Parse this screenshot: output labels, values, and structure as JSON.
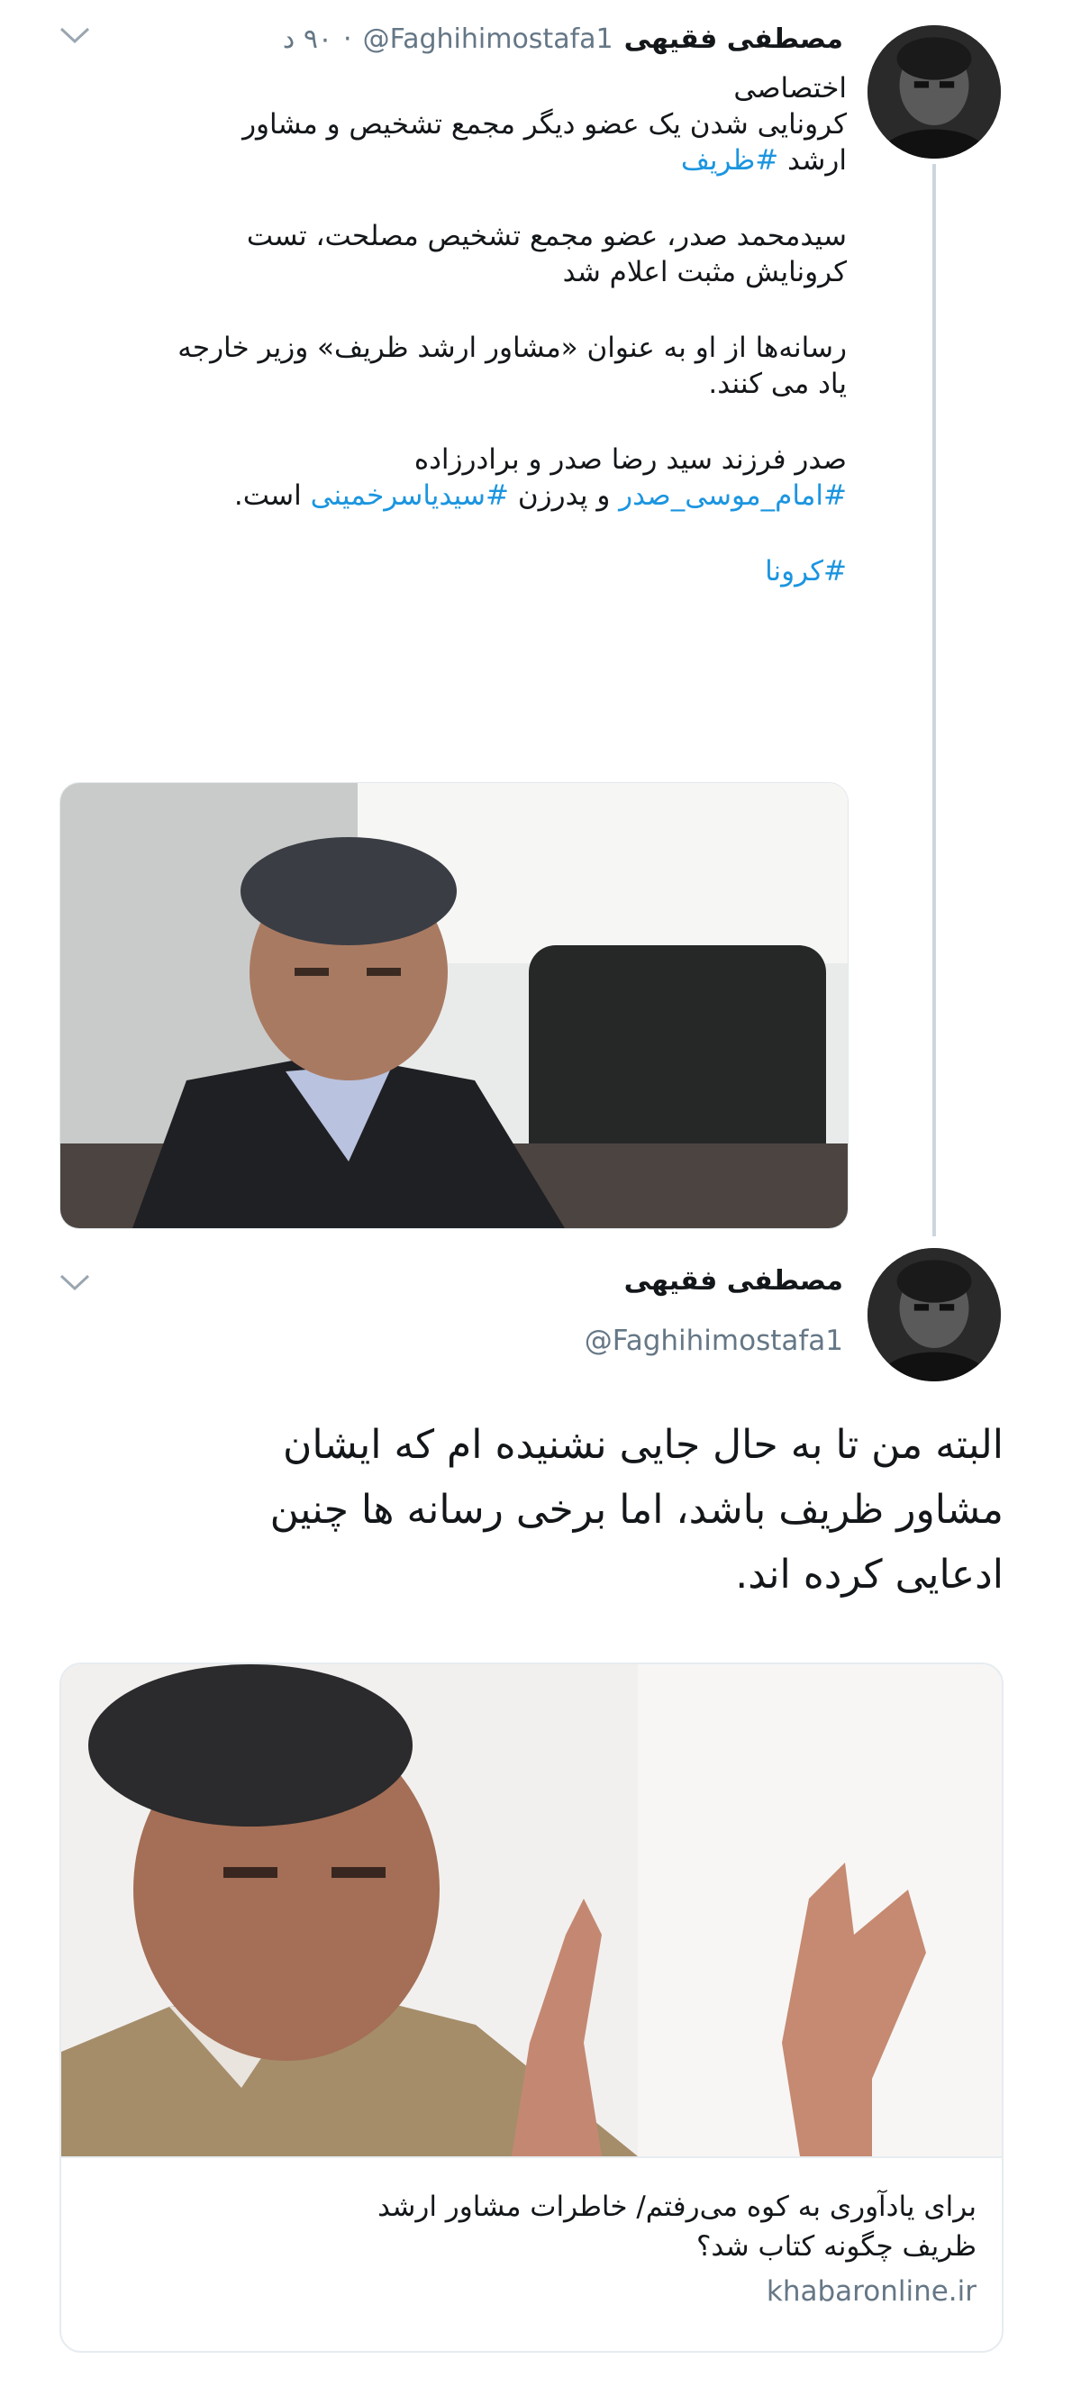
{
  "tweet1": {
    "display_name": "مصطفی فقیهی",
    "handle": "@Faghihimostafa1",
    "time": "۹۰ د",
    "lines": {
      "l1": "اختصاصی",
      "l2": "کرونایی شدن یک عضو دیگر مجمع تشخیص و مشاور",
      "l3_text": "ارشد",
      "l3_hashtag": "#ظریف",
      "p2_l1": "سیدمحمد صدر، عضو مجمع تشخیص مصلحت، تست",
      "p2_l2": "کرونایش مثبت اعلام شد",
      "p3_l1": "رسانه‌ها از او به عنوان «مشاور ارشد ظریف» وزیر خارجه",
      "p3_l2": "یاد می کنند.",
      "p4_l1": "صدر فرزند سید رضا صدر و برادرزاده",
      "p4_hashtag1": "#امام_موسی_صدر",
      "p4_mid": "و پدرزن",
      "p4_hashtag2": "#سیدیاسرخمینی",
      "p4_end": "است.",
      "p5_hashtag": "#کرونا"
    }
  },
  "tweet2": {
    "display_name": "مصطفی فقیهی",
    "handle": "@Faghihimostafa1",
    "body_l1": "البته من تا به حال جایی نشنیده ام که ایشان",
    "body_l2": "مشاور ظریف باشد، اما برخی رسانه ها چنین",
    "body_l3": "ادعایی کرده اند.",
    "card": {
      "caption_l1": "برای یادآوری به کوه می‌رفتم/ خاطرات مشاور ارشد",
      "caption_l2": "ظریف چگونه کتاب شد؟",
      "domain": "khabaronline.ir"
    }
  },
  "colors": {
    "hashtag": "#1b95e0",
    "secondary": "#657786",
    "thread_line": "#ccd6dd"
  }
}
